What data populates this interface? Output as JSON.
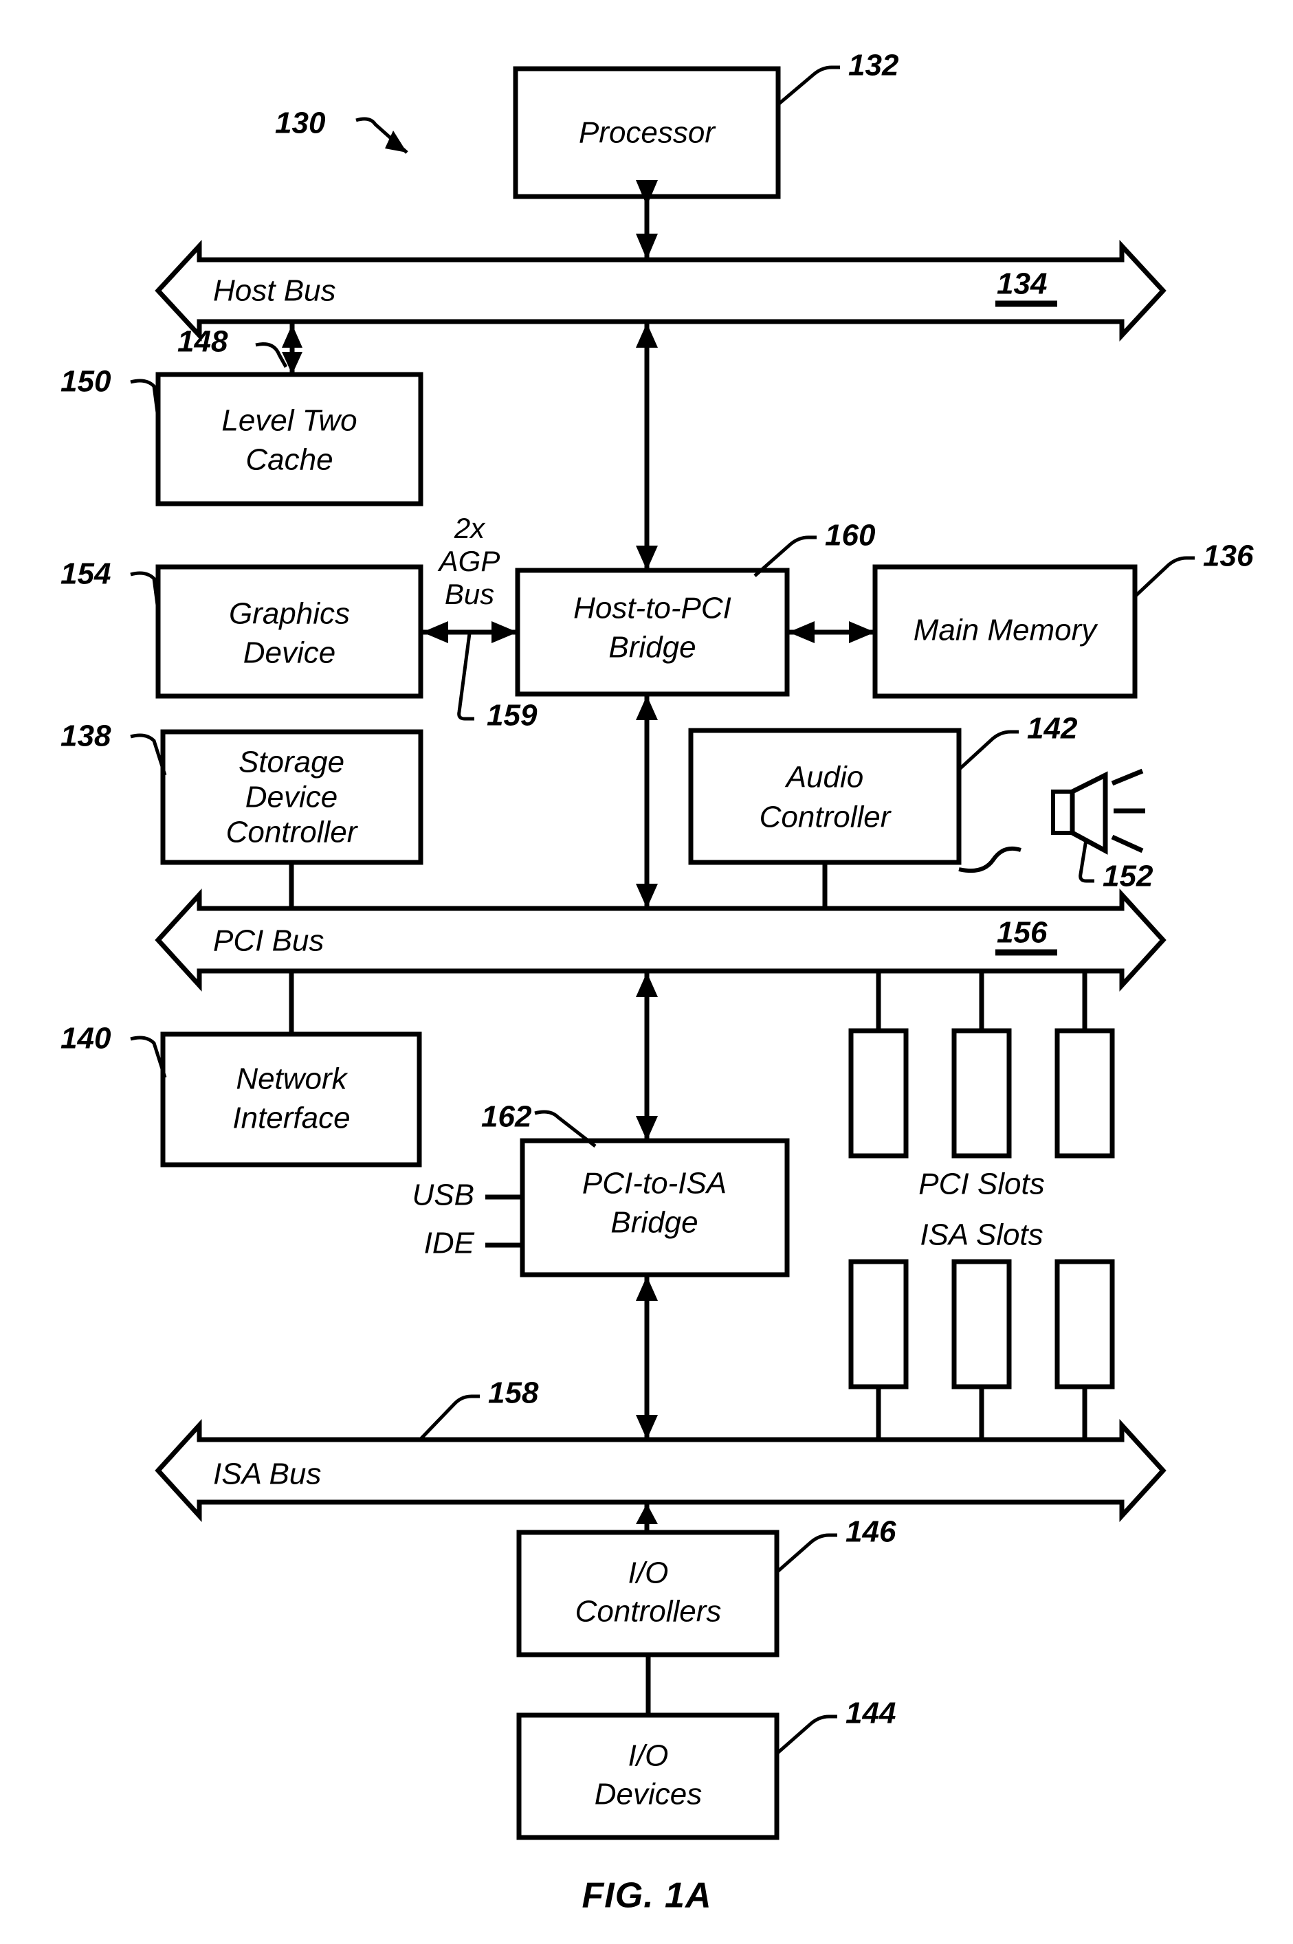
{
  "figure": {
    "caption": "FIG. 1A",
    "system_ref": "130"
  },
  "blocks": [
    {
      "id": "processor",
      "label_lines": [
        "Processor"
      ],
      "ref": "132"
    },
    {
      "id": "level-two-cache",
      "label_lines": [
        "Level Two",
        "Cache"
      ],
      "ref": "150"
    },
    {
      "id": "graphics-device",
      "label_lines": [
        "Graphics",
        "Device"
      ],
      "ref": "154"
    },
    {
      "id": "host-to-pci-bridge",
      "label_lines": [
        "Host-to-PCI",
        "Bridge"
      ],
      "ref": "160"
    },
    {
      "id": "main-memory",
      "label_lines": [
        "Main Memory"
      ],
      "ref": "136"
    },
    {
      "id": "storage-device-controller",
      "label_lines": [
        "Storage",
        "Device",
        "Controller"
      ],
      "ref": "138"
    },
    {
      "id": "audio-controller",
      "label_lines": [
        "Audio",
        "Controller"
      ],
      "ref": "142"
    },
    {
      "id": "network-interface",
      "label_lines": [
        "Network",
        "Interface"
      ],
      "ref": "140"
    },
    {
      "id": "pci-to-isa-bridge",
      "label_lines": [
        "PCI-to-ISA",
        "Bridge"
      ],
      "ref": "162"
    },
    {
      "id": "io-controllers",
      "label_lines": [
        "I/O",
        "Controllers"
      ],
      "ref": "146"
    },
    {
      "id": "io-devices",
      "label_lines": [
        "I/O",
        "Devices"
      ],
      "ref": "144"
    }
  ],
  "buses": [
    {
      "id": "host-bus",
      "label": "Host Bus",
      "ref": "134"
    },
    {
      "id": "pci-bus",
      "label": "PCI Bus",
      "ref": "156"
    },
    {
      "id": "isa-bus",
      "label": "ISA Bus",
      "ref": "158"
    }
  ],
  "connections": {
    "agp_bus_lines": [
      "2x",
      "AGP",
      "Bus"
    ],
    "agp_bus_ref": "159",
    "cache_link_ref": "148",
    "speaker_ref": "152"
  },
  "ports": [
    {
      "id": "usb",
      "label": "USB"
    },
    {
      "id": "ide",
      "label": "IDE"
    }
  ],
  "slot_groups": [
    {
      "id": "pci-slots",
      "label": "PCI Slots",
      "count": 3
    },
    {
      "id": "isa-slots",
      "label": "ISA Slots",
      "count": 3
    }
  ],
  "colors": {
    "ink": "#000000",
    "paper": "#ffffff"
  }
}
